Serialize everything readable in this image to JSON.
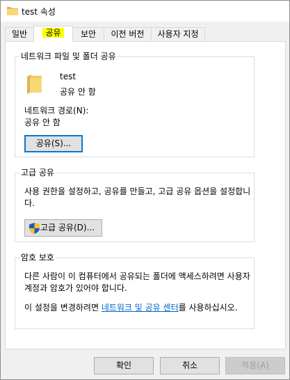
{
  "window": {
    "title": "test 속성"
  },
  "tabs": [
    {
      "label": "일반"
    },
    {
      "label": "공유"
    },
    {
      "label": "보안"
    },
    {
      "label": "이전 버전"
    },
    {
      "label": "사용자 지정"
    }
  ],
  "network_share": {
    "group_title": "네트워크 파일 및 폴더 공유",
    "folder_name": "test",
    "folder_status": "공유 안 함",
    "path_label": "네트워크 경로(N):",
    "path_value": "공유 안 함",
    "share_button": "공유(S)..."
  },
  "advanced_share": {
    "group_title": "고급 공유",
    "description_line1": "사용 권한을 설정하고, 공유를 만들고, 고급 공유 옵션을 설정합니",
    "description_line2": "다.",
    "button": "고급 공유(D)..."
  },
  "password_protection": {
    "group_title": "암호 보호",
    "line1": "다른 사람이 이 컴퓨터에서 공유되는 폴더에 액세스하려면 사용자",
    "line2": "계정과 암호가 있어야 합니다.",
    "line3_prefix": "이 설정을 변경하려면 ",
    "line3_link": "네트워크 및 공유 센터",
    "line3_suffix": "를 사용하십시오."
  },
  "footer": {
    "ok": "확인",
    "cancel": "취소",
    "apply": "적용(A)"
  },
  "colors": {
    "highlight": "#ffff00",
    "link": "#0066cc",
    "default_button_border": "#0078d7",
    "folder": "#f8d775"
  }
}
